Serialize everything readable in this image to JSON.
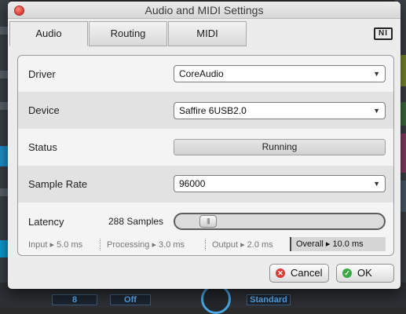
{
  "window": {
    "title": "Audio and MIDI Settings"
  },
  "tabs": [
    {
      "label": "Audio",
      "active": true
    },
    {
      "label": "Routing",
      "active": false
    },
    {
      "label": "MIDI",
      "active": false
    }
  ],
  "logo": {
    "text": "NI"
  },
  "settings": {
    "driver": {
      "label": "Driver",
      "value": "CoreAudio"
    },
    "device": {
      "label": "Device",
      "value": "Saffire 6USB2.0"
    },
    "status": {
      "label": "Status",
      "value": "Running"
    },
    "sample_rate": {
      "label": "Sample Rate",
      "value": "96000"
    },
    "latency": {
      "label": "Latency",
      "value": "288 Samples",
      "slider_fraction": 0.12,
      "thumb_glyph": "|||"
    }
  },
  "latency_breakdown": {
    "input": "Input ▸ 5.0 ms",
    "processing": "Processing  ▸ 3.0 ms",
    "output": "Output ▸ 2.0 ms",
    "overall": "Overall  ▸ 10.0 ms"
  },
  "buttons": {
    "cancel": {
      "label": "Cancel",
      "icon": "cancel-icon",
      "color": "#d93a35"
    },
    "ok": {
      "label": "OK",
      "icon": "check-icon",
      "color": "#3aa845"
    }
  },
  "background": {
    "field_1": "8",
    "field_2": "Off",
    "field_3": "Standard"
  },
  "colors": {
    "accent": "#1d8fc9"
  }
}
